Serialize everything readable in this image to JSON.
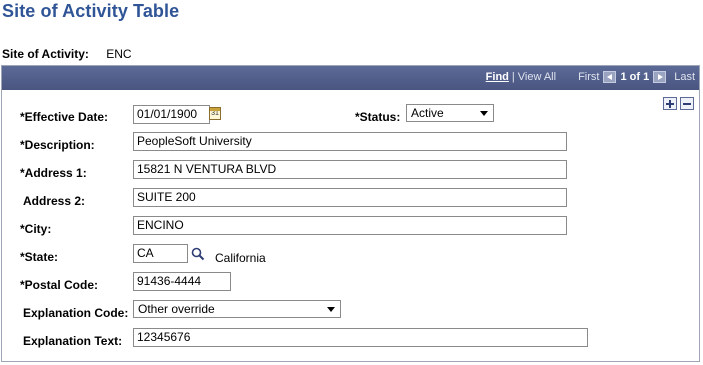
{
  "page": {
    "title": "Site of Activity Table"
  },
  "key": {
    "label": "Site of Activity:",
    "value": "ENC"
  },
  "nav": {
    "find": "Find",
    "separator": "|",
    "view_all": "View All",
    "first": "First",
    "count": "1 of 1",
    "last": "Last"
  },
  "form": {
    "effective_date": {
      "label": "*Effective Date:",
      "value": "01/01/1900"
    },
    "status": {
      "label": "*Status:",
      "value": "Active"
    },
    "description": {
      "label": "*Description:",
      "value": "PeopleSoft University"
    },
    "address1": {
      "label": "*Address 1:",
      "value": "15821 N VENTURA BLVD"
    },
    "address2": {
      "label": "Address 2:",
      "value": "SUITE 200"
    },
    "city": {
      "label": "*City:",
      "value": "ENCINO"
    },
    "state": {
      "label": "*State:",
      "value": "CA",
      "description": "California"
    },
    "postal_code": {
      "label": "*Postal Code:",
      "value": "91436-4444"
    },
    "explanation_code": {
      "label": "Explanation Code:",
      "value": "Other override"
    },
    "explanation_text": {
      "label": "Explanation Text:",
      "value": "12345676"
    }
  },
  "icons": {
    "calendar": "calendar-icon",
    "lookup": "lookup-search-icon",
    "add": "add-row-icon",
    "delete": "delete-row-icon"
  },
  "colors": {
    "title": "#2f5597",
    "header": "#4f5b87"
  }
}
